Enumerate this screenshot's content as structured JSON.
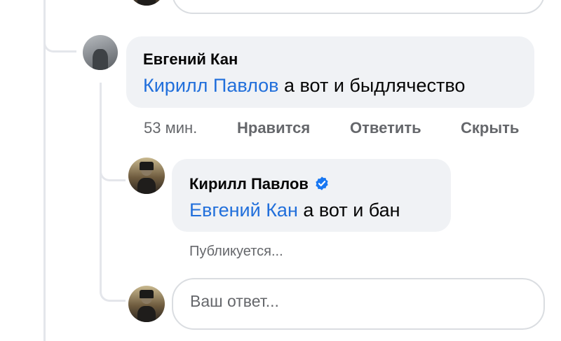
{
  "comments": [
    {
      "author": "Евгений Кан",
      "mention": "Кирилл Павлов",
      "text": " а вот и быдлячество",
      "time": "53 мин.",
      "like_label": "Нравится",
      "reply_label": "Ответить",
      "hide_label": "Скрыть"
    },
    {
      "author": "Кирилл Павлов",
      "verified": true,
      "mention": "Евгений Кан",
      "text": " а вот и бан",
      "status": "Публикуется..."
    }
  ],
  "reply_box": {
    "placeholder": "Ваш ответ..."
  },
  "colors": {
    "mention": "#216fdb",
    "verified": "#1877f2",
    "bubble": "#f0f2f5",
    "meta": "#65676b"
  }
}
